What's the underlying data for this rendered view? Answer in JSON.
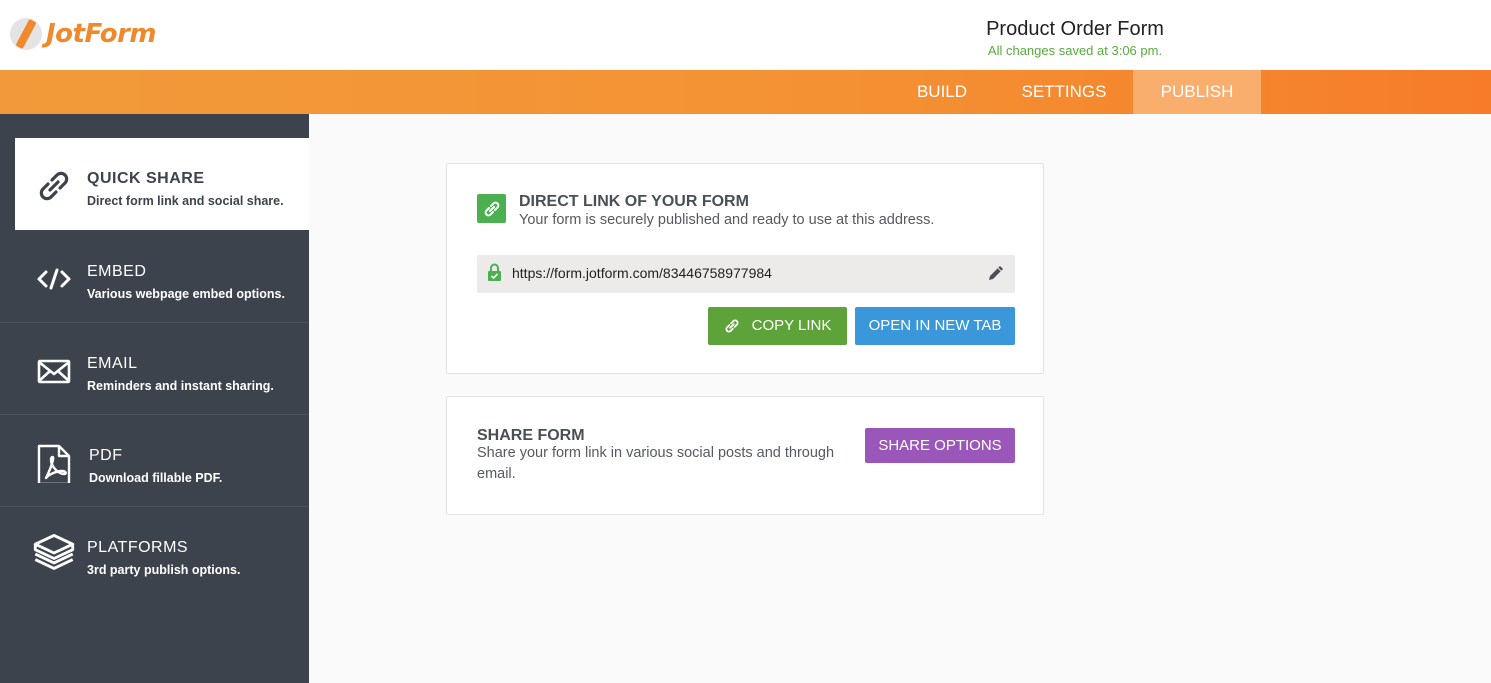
{
  "app": {
    "logo_text": "JotForm",
    "form_title": "Product Order Form",
    "save_status": "All changes saved at 3:06 pm."
  },
  "nav": {
    "tabs": [
      {
        "label": "BUILD"
      },
      {
        "label": "SETTINGS"
      },
      {
        "label": "PUBLISH",
        "active": true
      }
    ]
  },
  "sidebar": {
    "items": [
      {
        "label": "QUICK SHARE",
        "desc": "Direct form link and social share.",
        "icon": "link-icon",
        "active": true
      },
      {
        "label": "EMBED",
        "desc": "Various webpage embed options.",
        "icon": "code-icon"
      },
      {
        "label": "EMAIL",
        "desc": "Reminders and instant sharing.",
        "icon": "envelope-icon"
      },
      {
        "label": "PDF",
        "desc": "Download fillable PDF.",
        "icon": "pdf-icon"
      },
      {
        "label": "PLATFORMS",
        "desc": "3rd party publish options.",
        "icon": "layers-icon"
      }
    ]
  },
  "direct_link": {
    "title": "DIRECT LINK OF YOUR FORM",
    "subtitle": "Your form is securely published and ready to use at this address.",
    "url": "https://form.jotform.com/83446758977984",
    "copy_label": "COPY LINK",
    "open_label": "OPEN IN NEW TAB"
  },
  "share_form": {
    "title": "SHARE FORM",
    "subtitle": "Share your form link in various social posts and through email.",
    "button_label": "SHARE OPTIONS"
  },
  "colors": {
    "accent_orange": "#f49233",
    "sidebar_bg": "#3d434d",
    "copy_green": "#5ea33a",
    "open_blue": "#3a97d9",
    "share_purple": "#9a56b8"
  }
}
